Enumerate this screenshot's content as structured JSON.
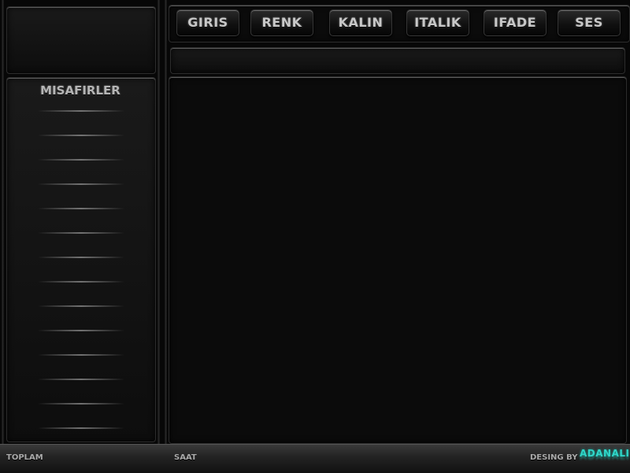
{
  "toolbar": {
    "buttons": [
      {
        "label": "GIRIS"
      },
      {
        "label": "RENK"
      },
      {
        "label": "KALIN"
      },
      {
        "label": "ITALIK"
      },
      {
        "label": "IFADE"
      },
      {
        "label": "SES"
      }
    ]
  },
  "sidebar": {
    "title": "MISAFIRLER"
  },
  "footer": {
    "total_label": "TOPLAM",
    "time_label": "SAAT",
    "credit_prefix": "DESING BY",
    "credit_name": "ADANALI"
  },
  "colors": {
    "background": "#0a0a0a",
    "accent": "#2fd6c8",
    "text": "#b5b5b5"
  }
}
